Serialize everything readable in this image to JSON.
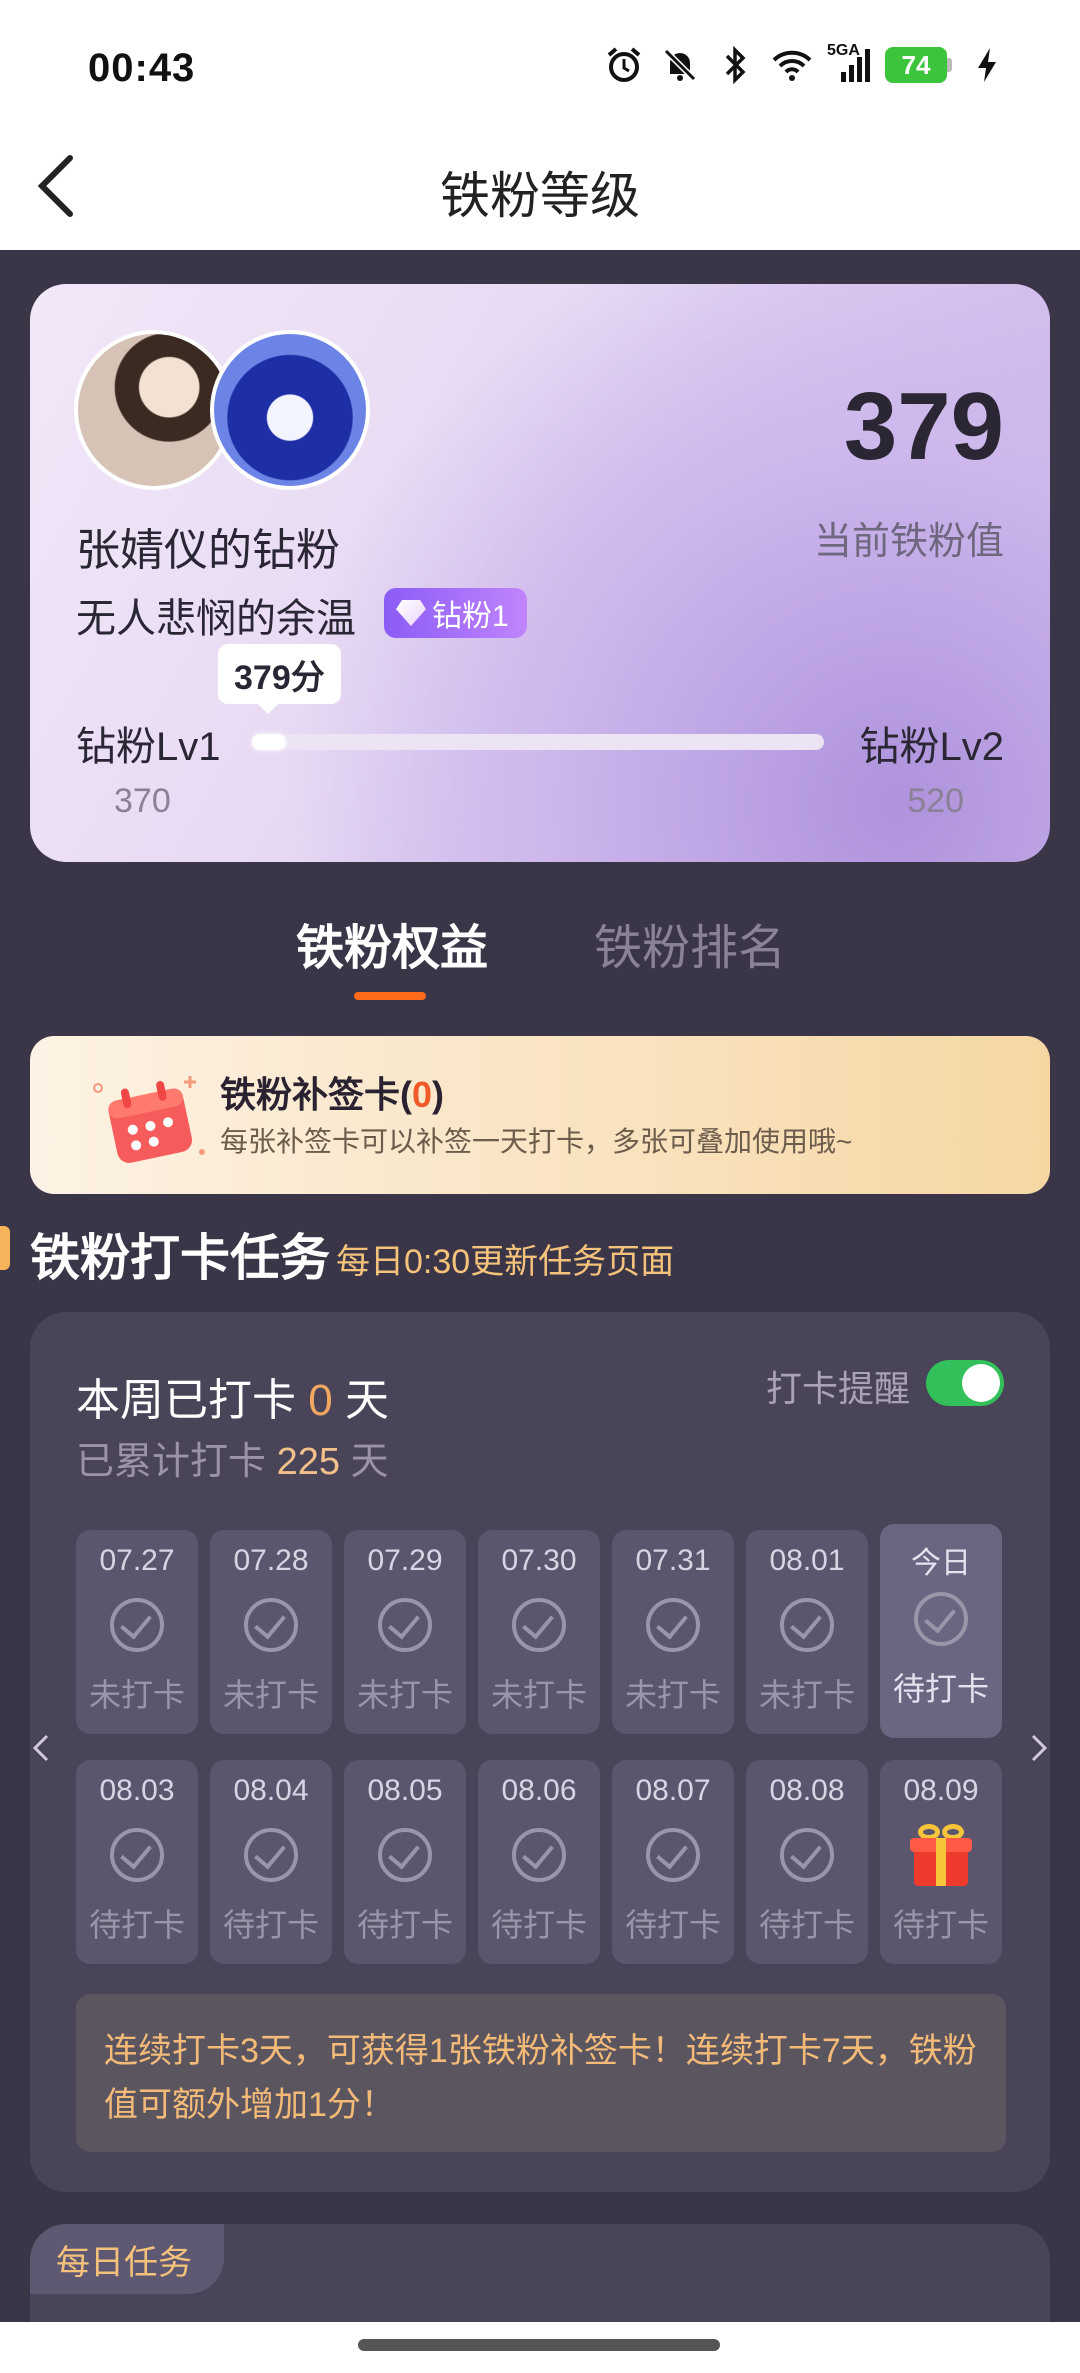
{
  "status_bar": {
    "time": "00:43",
    "network": "5GA",
    "battery": "74"
  },
  "header": {
    "title": "铁粉等级"
  },
  "profile": {
    "name": "张婧仪的钻粉",
    "nickname": "无人悲悯的余温",
    "badge": "钻粉1",
    "value": "379",
    "value_label": "当前铁粉值",
    "progress_tip": "379分",
    "level_from": "钻粉Lv1",
    "level_to": "钻粉Lv2",
    "level_from_value": "370",
    "level_to_value": "520",
    "progress": 0.06
  },
  "tabs": [
    {
      "label": "铁粉权益",
      "active": true
    },
    {
      "label": "铁粉排名",
      "active": false
    }
  ],
  "makeup_card": {
    "title": "铁粉补签卡(",
    "count": "0",
    "title_end": ")",
    "desc": "每张补签卡可以补签一天打卡，多张可叠加使用哦~"
  },
  "checkin_section": {
    "title": "铁粉打卡任务",
    "subtitle": "每日0:30更新任务页面"
  },
  "checkin": {
    "week_prefix": "本周已打卡",
    "week_days": "0",
    "week_suffix": "天",
    "total_prefix": "已累计打卡",
    "total_days": "225",
    "total_suffix": "天",
    "remind_label": "打卡提醒",
    "remind_on": true,
    "days": [
      {
        "date": "07.27",
        "status": "未打卡"
      },
      {
        "date": "07.28",
        "status": "未打卡"
      },
      {
        "date": "07.29",
        "status": "未打卡"
      },
      {
        "date": "07.30",
        "status": "未打卡"
      },
      {
        "date": "07.31",
        "status": "未打卡"
      },
      {
        "date": "08.01",
        "status": "未打卡"
      },
      {
        "date": "今日",
        "status": "待打卡"
      },
      {
        "date": "08.03",
        "status": "待打卡"
      },
      {
        "date": "08.04",
        "status": "待打卡"
      },
      {
        "date": "08.05",
        "status": "待打卡"
      },
      {
        "date": "08.06",
        "status": "待打卡"
      },
      {
        "date": "08.07",
        "status": "待打卡"
      },
      {
        "date": "08.08",
        "status": "待打卡"
      },
      {
        "date": "08.09",
        "status": "待打卡"
      }
    ],
    "reward_tip": "连续打卡3天，可获得1张铁粉补签卡！连续打卡7天，铁粉值可额外增加1分！"
  },
  "daily_task": {
    "label": "每日任务"
  }
}
